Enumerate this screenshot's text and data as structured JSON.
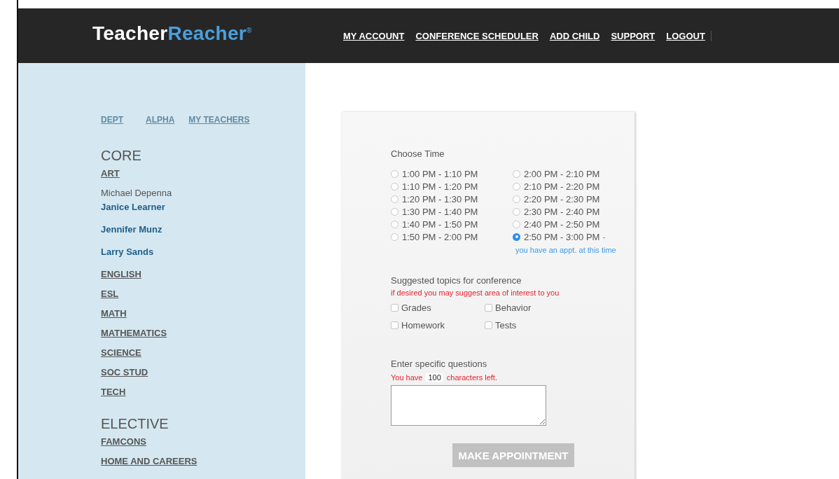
{
  "header": {
    "logo": {
      "first": "Teacher",
      "second": "Reacher",
      "mark": "®"
    },
    "nav": [
      "MY ACCOUNT",
      "CONFERENCE SCHEDULER",
      "ADD CHILD",
      "SUPPORT",
      "LOGOUT"
    ]
  },
  "sidebar": {
    "tabs": [
      "DEPT",
      "ALPHA",
      "MY TEACHERS"
    ],
    "groups": [
      {
        "heading": "CORE",
        "items": [
          {
            "kind": "dept",
            "label": "ART"
          },
          {
            "kind": "name",
            "label": "Michael Depenna"
          },
          {
            "kind": "teacher",
            "label": "Janice Learner"
          },
          {
            "kind": "teacher",
            "label": "Jennifer Munz"
          },
          {
            "kind": "teacher",
            "label": "Larry Sands"
          },
          {
            "kind": "dept",
            "label": "ENGLISH"
          },
          {
            "kind": "dept",
            "label": "ESL"
          },
          {
            "kind": "dept",
            "label": "MATH"
          },
          {
            "kind": "dept",
            "label": "MATHEMATICS"
          },
          {
            "kind": "dept",
            "label": "SCIENCE"
          },
          {
            "kind": "dept",
            "label": "SOC STUD"
          },
          {
            "kind": "dept",
            "label": "TECH"
          }
        ]
      },
      {
        "heading": "ELECTIVE",
        "items": [
          {
            "kind": "dept",
            "label": "FAMCONS"
          },
          {
            "kind": "dept",
            "label": "HOME AND CAREERS"
          }
        ]
      }
    ]
  },
  "form": {
    "time_title": "Choose Time",
    "time_columns": [
      [
        {
          "label": "1:00 PM - 1:10 PM",
          "selected": false
        },
        {
          "label": "1:10 PM - 1:20 PM",
          "selected": false
        },
        {
          "label": "1:20 PM - 1:30 PM",
          "selected": false
        },
        {
          "label": "1:30 PM - 1:40 PM",
          "selected": false
        },
        {
          "label": "1:40 PM - 1:50 PM",
          "selected": false
        },
        {
          "label": "1:50 PM - 2:00 PM",
          "selected": false
        }
      ],
      [
        {
          "label": "2:00 PM - 2:10 PM",
          "selected": false
        },
        {
          "label": "2:10 PM - 2:20 PM",
          "selected": false
        },
        {
          "label": "2:20 PM - 2:30 PM",
          "selected": false
        },
        {
          "label": "2:30 PM - 2:40 PM",
          "selected": false
        },
        {
          "label": "2:40 PM - 2:50 PM",
          "selected": false
        },
        {
          "label": "2:50 PM - 3:00 PM",
          "selected": true,
          "suffix": "-"
        }
      ]
    ],
    "appointment_note": "you have an appt. at this time",
    "topics_title": "Suggested topics for conference",
    "topics_hint": "if desired you may suggest area of interest to you",
    "topics": [
      {
        "label": "Grades",
        "checked": false
      },
      {
        "label": "Behavior",
        "checked": false
      },
      {
        "label": "Homework",
        "checked": false
      },
      {
        "label": "Tests",
        "checked": false
      }
    ],
    "questions_title": "Enter specific questions",
    "counter": {
      "before": "You have",
      "count": "100",
      "after": "characters left."
    },
    "submit": {
      "label": "MAKE APPOINTMENT",
      "disabled": true
    }
  }
}
